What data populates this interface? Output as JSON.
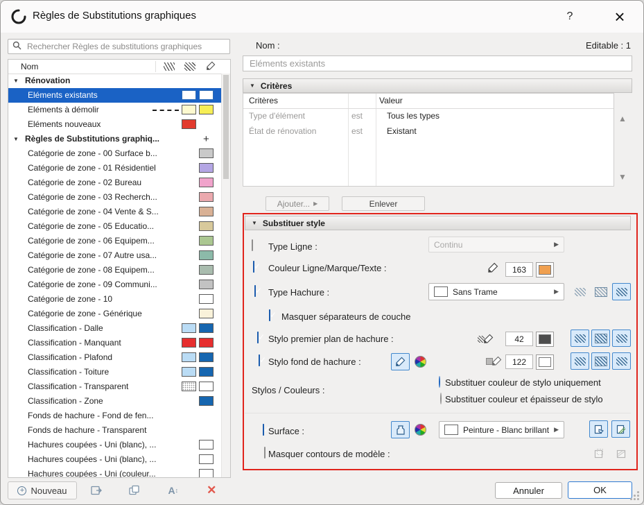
{
  "window": {
    "title": "Règles de Substitutions graphiques",
    "help_label": "?",
    "close_label": "×"
  },
  "search": {
    "placeholder": "Rechercher Règles de substitutions graphiques"
  },
  "list": {
    "header": "Nom",
    "items": [
      {
        "kind": "group",
        "label": "Rénovation"
      },
      {
        "kind": "item",
        "label": "Eléments existants",
        "selected": true,
        "sw1": "#ffffff",
        "sw2": "#ffffff",
        "swb": "#2d6bb4"
      },
      {
        "kind": "item",
        "label": "Eléments à démolir",
        "dashed": true,
        "sw1": "#fdf9cf",
        "sw2": "#f6ee55"
      },
      {
        "kind": "item",
        "label": "Eléments nouveaux",
        "sw1": "#e23b2e"
      },
      {
        "kind": "group",
        "label": "Règles de Substitutions graphiq...",
        "plus": "+"
      },
      {
        "kind": "item",
        "label": "Catégorie de zone - 00 Surface b...",
        "sw2": "#c9c9c9"
      },
      {
        "kind": "item",
        "label": "Catégorie de zone - 01 Résidentiel",
        "sw2": "#b4a6e4"
      },
      {
        "kind": "item",
        "label": "Catégorie de zone - 02 Bureau",
        "sw2": "#f0a3cb"
      },
      {
        "kind": "item",
        "label": "Catégorie de zone - 03 Recherch...",
        "sw2": "#eba9ae"
      },
      {
        "kind": "item",
        "label": "Catégorie de zone - 04 Vente & S...",
        "sw2": "#d9b195"
      },
      {
        "kind": "item",
        "label": "Catégorie de zone - 05 Educatio...",
        "sw2": "#d8c99b"
      },
      {
        "kind": "item",
        "label": "Catégorie de zone - 06 Equipem...",
        "sw2": "#abc791"
      },
      {
        "kind": "item",
        "label": "Catégorie de zone - 07 Autre usa...",
        "sw2": "#8cbaa9"
      },
      {
        "kind": "item",
        "label": "Catégorie de zone - 08 Equipem...",
        "sw2": "#a9bcae"
      },
      {
        "kind": "item",
        "label": "Catégorie de zone - 09 Communi...",
        "sw2": "#c2c2c2"
      },
      {
        "kind": "item",
        "label": "Catégorie de zone - 10",
        "sw2": "#ffffff"
      },
      {
        "kind": "item",
        "label": "Catégorie de zone - Générique",
        "sw2": "#f9f2da"
      },
      {
        "kind": "item",
        "label": "Classification - Dalle",
        "sw1": "#badcf5",
        "sw2": "#1666b0"
      },
      {
        "kind": "item",
        "label": "Classification - Manquant",
        "sw1": "#e62e2e",
        "sw2": "#e62e2e"
      },
      {
        "kind": "item",
        "label": "Classification - Plafond",
        "sw1": "#badcf5",
        "sw2": "#1666b0"
      },
      {
        "kind": "item",
        "label": "Classification - Toiture",
        "sw1": "#badcf5",
        "sw2": "#1666b0"
      },
      {
        "kind": "item",
        "label": "Classification - Transparent",
        "sw1": "pattern",
        "sw2": "#ffffff"
      },
      {
        "kind": "item",
        "label": "Classification - Zone",
        "sw2": "#1666b0"
      },
      {
        "kind": "item",
        "label": "Fonds de hachure - Fond de fen..."
      },
      {
        "kind": "item",
        "label": "Fonds de hachure - Transparent"
      },
      {
        "kind": "item",
        "label": "Hachures coupées - Uni (blanc), ...",
        "sw2": "#ffffff"
      },
      {
        "kind": "item",
        "label": "Hachures coupées - Uni (blanc), ...",
        "sw2": "#ffffff"
      },
      {
        "kind": "item",
        "label": "Hachures coupées - Uni (couleur...",
        "sw2": "#ffffff"
      }
    ]
  },
  "toolbar": {
    "new_label": "Nouveau"
  },
  "detail": {
    "name_label": "Nom :",
    "editable_label": "Editable : 1",
    "name_value": "Eléments existants"
  },
  "criteria": {
    "header": "Critères",
    "col_criteria": "Critères",
    "col_value": "Valeur",
    "rows": [
      {
        "name": "Type d'élément",
        "op": "est",
        "value": "Tous les types"
      },
      {
        "name": "État de rénovation",
        "op": "est",
        "value": "Existant"
      }
    ],
    "add_label": "Ajouter...",
    "remove_label": "Enlever"
  },
  "override": {
    "header": "Substituer style",
    "line_type_label": "Type Ligne :",
    "line_type_value": "Continu",
    "line_color_label": "Couleur Ligne/Marque/Texte :",
    "line_pen_value": "163",
    "line_pen_color": "#f0a050",
    "fill_type_label": "Type Hachure :",
    "fill_type_value": "Sans Trame",
    "fill_type_swatch": "#ffffff",
    "skin_sep_label": "Masquer séparateurs de couche",
    "fg_pen_label": "Stylo premier plan de hachure :",
    "fg_pen_value": "42",
    "fg_pen_color": "#4d4d4d",
    "bg_pen_label": "Stylo fond de hachure :",
    "bg_pen_value": "122",
    "bg_pen_color": "#ffffff",
    "pens_label": "Stylos / Couleurs :",
    "radio_pen_only": "Substituer couleur de stylo uniquement",
    "radio_pen_weight": "Substituer couleur et épaisseur de stylo",
    "surface_label": "Surface :",
    "surface_value": "Peinture - Blanc brillant",
    "surface_swatch": "#ffffff",
    "hide_contours_label": "Masquer contours de modèle :"
  },
  "footer": {
    "cancel_label": "Annuler",
    "ok_label": "OK"
  }
}
